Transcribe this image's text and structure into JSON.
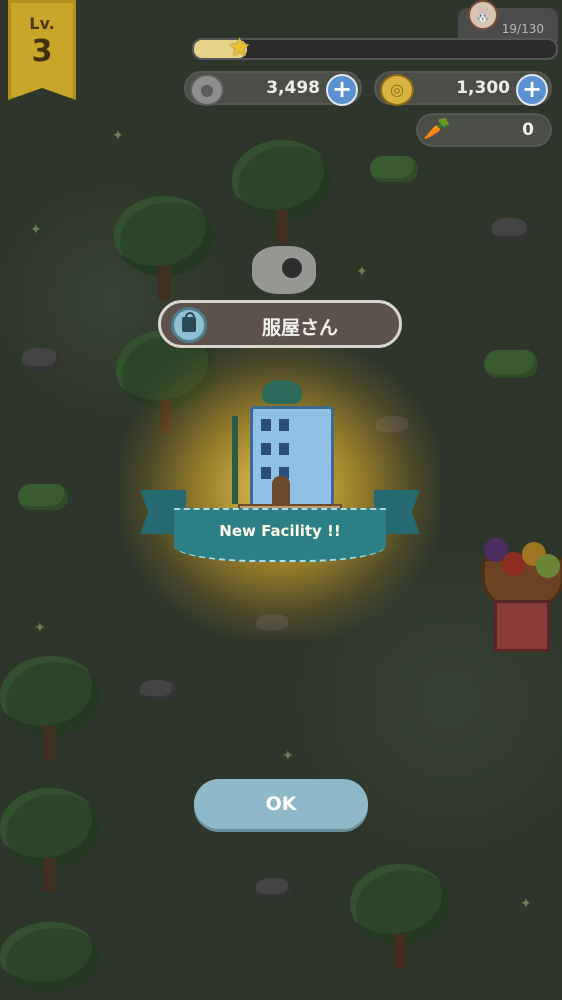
{
  "hud": {
    "level": {
      "prefix": "Lv.",
      "value": "3"
    },
    "xp": {
      "count_text": "19/130",
      "progress_fraction": 0.146
    },
    "stone": {
      "value": "3,498",
      "icon": "stone-icon",
      "add_icon": "plus-icon"
    },
    "coin": {
      "value": "1,300",
      "icon": "coin-icon",
      "add_icon": "plus-icon"
    },
    "carrot": {
      "value": "0",
      "icon": "carrot-icon"
    }
  },
  "modal": {
    "facility_name": "服屋さん",
    "facility_icon": "shopping-bag-icon",
    "ribbon_text": "New Facility !!",
    "ok_label": "OK"
  },
  "colors": {
    "ribbon": "#2d7f86",
    "ok_button": "#8fb9c9",
    "plus_button": "#5b90d1",
    "level_banner": "#c9a52a"
  }
}
